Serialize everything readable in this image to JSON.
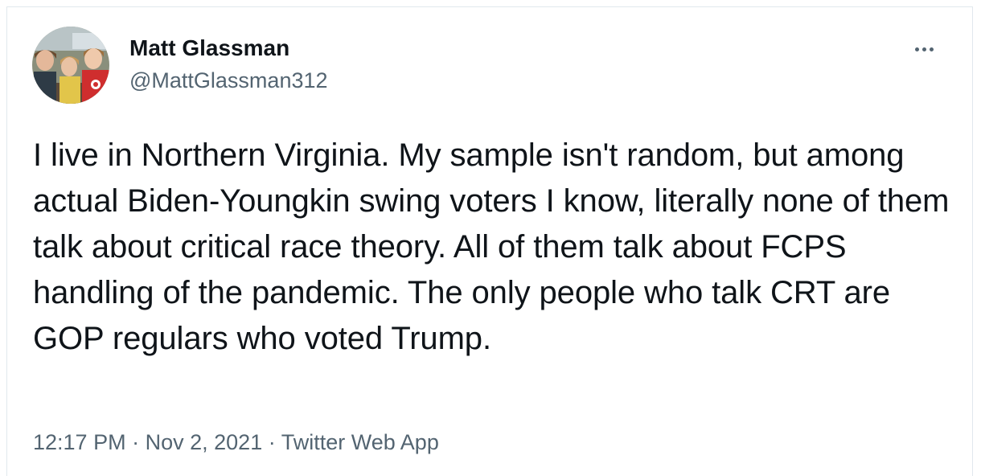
{
  "tweet": {
    "author": {
      "name": "Matt Glassman",
      "handle": "@MattGlassman312"
    },
    "text": "I live in Northern Virginia. My sample isn't random, but among actual Biden-Youngkin swing voters I know, literally none of them talk about critical race theory. All of them talk about FCPS handling of the pandemic. The only people who talk CRT are GOP regulars who voted Trump.",
    "meta": {
      "time": "12:17 PM",
      "separator": "·",
      "date": "Nov 2, 2021",
      "source": "Twitter Web App"
    },
    "icons": {
      "more": "more-horizontal-icon",
      "avatar": "avatar-photo"
    },
    "colors": {
      "name": "#0f1419",
      "secondary": "#536471",
      "border": "#e1e8ed"
    }
  }
}
